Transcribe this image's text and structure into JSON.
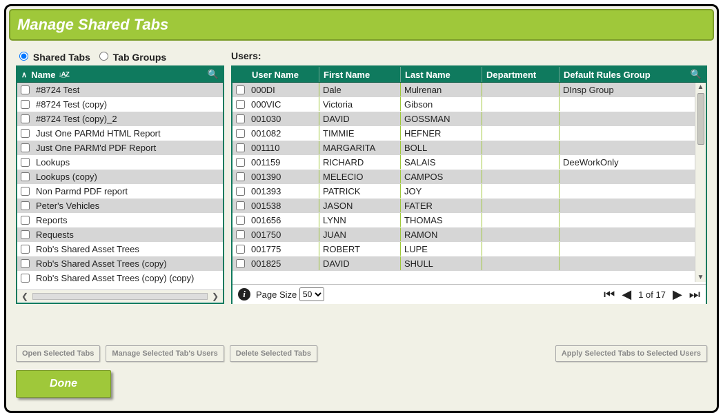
{
  "window": {
    "title": "Manage Shared Tabs"
  },
  "mode": {
    "shared_tabs_label": "Shared Tabs",
    "tab_groups_label": "Tab Groups",
    "selected": "shared_tabs"
  },
  "labels": {
    "users": "Users:",
    "name_header": "Name",
    "page_size": "Page Size"
  },
  "tabs_grid": {
    "rows": [
      {
        "name": "#8724 Test"
      },
      {
        "name": "#8724 Test (copy)"
      },
      {
        "name": "#8724 Test (copy)_2"
      },
      {
        "name": "Just One PARMd HTML Report"
      },
      {
        "name": "Just One PARM'd PDF Report"
      },
      {
        "name": "Lookups"
      },
      {
        "name": "Lookups (copy)"
      },
      {
        "name": "Non Parmd PDF report"
      },
      {
        "name": "Peter's Vehicles"
      },
      {
        "name": "Reports"
      },
      {
        "name": "Requests"
      },
      {
        "name": "Rob's Shared Asset Trees"
      },
      {
        "name": "Rob's Shared Asset Trees (copy)"
      },
      {
        "name": "Rob's Shared Asset Trees (copy) (copy)"
      }
    ]
  },
  "users_grid": {
    "columns": {
      "user_name": "User Name",
      "first_name": "First Name",
      "last_name": "Last Name",
      "department": "Department",
      "default_rules_group": "Default Rules Group"
    },
    "rows": [
      {
        "user_name": "000DI",
        "first_name": "Dale",
        "last_name": "Mulrenan",
        "department": "",
        "rules": "DInsp Group"
      },
      {
        "user_name": "000VIC",
        "first_name": "Victoria",
        "last_name": "Gibson",
        "department": "",
        "rules": ""
      },
      {
        "user_name": "001030",
        "first_name": "DAVID",
        "last_name": "GOSSMAN",
        "department": "",
        "rules": ""
      },
      {
        "user_name": "001082",
        "first_name": "TIMMIE",
        "last_name": "HEFNER",
        "department": "",
        "rules": ""
      },
      {
        "user_name": "001110",
        "first_name": "MARGARITA",
        "last_name": "BOLL",
        "department": "",
        "rules": ""
      },
      {
        "user_name": "001159",
        "first_name": "RICHARD",
        "last_name": "SALAIS",
        "department": "",
        "rules": "DeeWorkOnly"
      },
      {
        "user_name": "001390",
        "first_name": "MELECIO",
        "last_name": "CAMPOS",
        "department": "",
        "rules": ""
      },
      {
        "user_name": "001393",
        "first_name": "PATRICK",
        "last_name": "JOY",
        "department": "",
        "rules": ""
      },
      {
        "user_name": "001538",
        "first_name": "JASON",
        "last_name": "FATER",
        "department": "",
        "rules": ""
      },
      {
        "user_name": "001656",
        "first_name": "LYNN",
        "last_name": "THOMAS",
        "department": "",
        "rules": ""
      },
      {
        "user_name": "001750",
        "first_name": "JUAN",
        "last_name": "RAMON",
        "department": "",
        "rules": ""
      },
      {
        "user_name": "001775",
        "first_name": "ROBERT",
        "last_name": "LUPE",
        "department": "",
        "rules": ""
      },
      {
        "user_name": "001825",
        "first_name": "DAVID",
        "last_name": "SHULL",
        "department": "",
        "rules": ""
      }
    ],
    "page_size_options": [
      "50"
    ],
    "page_size_selected": "50",
    "page_info": "1 of 17"
  },
  "buttons": {
    "open_selected": "Open Selected Tabs",
    "manage_users": "Manage Selected Tab's Users",
    "delete_selected": "Delete Selected Tabs",
    "apply_users": "Apply Selected Tabs to Selected Users",
    "done": "Done"
  }
}
